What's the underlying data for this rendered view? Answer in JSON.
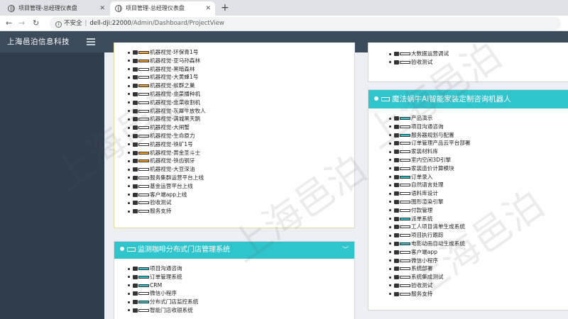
{
  "browser": {
    "tabs": [
      {
        "title": "项目管理-总经理仪表盘",
        "active": false
      },
      {
        "title": "项目管理-总经理仪表盘",
        "active": true
      }
    ],
    "insecure_label": "不安全",
    "host": "dell-dji:22000",
    "path": "/Admin/Dashboard/ProjectView"
  },
  "app": {
    "brand": "上海邑泊信息科技"
  },
  "panel_left_top": {
    "items": [
      {
        "label": "机器视觉-环保青1号",
        "icon": "robot-icon",
        "bar": "orange"
      },
      {
        "label": "机器视觉-亚马孙森林",
        "icon": "robot-icon",
        "bar": "orange"
      },
      {
        "label": "机器视觉-黑暗森林",
        "icon": "robot-icon",
        "bar": "white"
      },
      {
        "label": "机器视觉-大黄蜂1号",
        "icon": "robot-icon",
        "bar": "white"
      },
      {
        "label": "机器视觉-蚁群之巢",
        "icon": "robot-icon",
        "bar": "orange"
      },
      {
        "label": "机器视觉-韭菜播种机",
        "icon": "robot-icon",
        "bar": "white"
      },
      {
        "label": "机器视觉-韭菜收割机",
        "icon": "robot-icon",
        "bar": "white"
      },
      {
        "label": "机器视觉-灰犀牛放牧人",
        "icon": "robot-icon",
        "bar": "white"
      },
      {
        "label": "机器视觉-满城黑天鹅",
        "icon": "robot-icon",
        "bar": "white"
      },
      {
        "label": "机器视觉-大闸蟹",
        "icon": "robot-icon",
        "bar": "white"
      },
      {
        "label": "机器视觉-生命原力",
        "icon": "robot-icon",
        "bar": "white"
      },
      {
        "label": "机器视觉-铁矿1号",
        "icon": "robot-icon",
        "bar": "white"
      },
      {
        "label": "机器视觉-黄金圣斗士",
        "icon": "robot-icon",
        "bar": "orange"
      },
      {
        "label": "机器视觉-铁齿钢牙",
        "icon": "robot-icon",
        "bar": "orange"
      },
      {
        "label": "机器视觉-大豆深油",
        "icon": "robot-icon",
        "bar": "white"
      },
      {
        "label": "服务集群运营平台上线",
        "icon": "send-icon",
        "bar": "white"
      },
      {
        "label": "基金运营平台上线",
        "icon": "send-icon",
        "bar": "white"
      },
      {
        "label": "客户端app上线",
        "icon": "cube-icon",
        "bar": "white"
      },
      {
        "label": "验收测试",
        "icon": "users-icon",
        "bar": "white"
      },
      {
        "label": "服务支持",
        "icon": "arrow-up-icon",
        "bar": "white"
      }
    ]
  },
  "panel_left_bottom": {
    "title": "监测咖啡分布式门店管理系统",
    "items": [
      {
        "label": "项目沟通咨询",
        "icon": "chat-icon",
        "bar": "teal"
      },
      {
        "label": "订单管理系统",
        "icon": "cube-icon",
        "bar": "teal"
      },
      {
        "label": "CRM",
        "icon": "cube-icon",
        "bar": "teal"
      },
      {
        "label": "微信小程序",
        "icon": "cube-icon",
        "bar": "white"
      },
      {
        "label": "分布式门店监控系统",
        "icon": "cube-icon",
        "bar": "teal"
      },
      {
        "label": "智能门店收银系统",
        "icon": "cube-icon",
        "bar": "white"
      }
    ]
  },
  "panel_right_top": {
    "items": [
      {
        "label": "大数据运营调试",
        "icon": "cube-icon",
        "bar": "white"
      },
      {
        "label": "验收测试",
        "icon": "sign-in-icon",
        "bar": "white"
      }
    ]
  },
  "panel_right_main": {
    "title": "魔法蜗牛AI智能家装定制咨询机器人",
    "items": [
      {
        "label": "产品演示",
        "icon": "grid-icon",
        "bar": "teal"
      },
      {
        "label": "项目沟通咨询",
        "icon": "chat-icon",
        "bar": "white"
      },
      {
        "label": "服务器规划与配置",
        "icon": "server-icon",
        "bar": "teal"
      },
      {
        "label": "订单管理产品云平台部署",
        "icon": "anchor-icon",
        "bar": "white"
      },
      {
        "label": "家装材料库",
        "icon": "wrench-icon",
        "bar": "white"
      },
      {
        "label": "室内空间3D引擎",
        "icon": "bell-icon",
        "bar": "white"
      },
      {
        "label": "家装造价计算模块",
        "icon": "calendar-icon",
        "bar": "white"
      },
      {
        "label": "订单录入",
        "icon": "check-icon",
        "bar": "teal"
      },
      {
        "label": "自然语言处理",
        "icon": "chat-icon",
        "bar": "white"
      },
      {
        "label": "语料库设计",
        "icon": "sitemap-icon",
        "bar": "white"
      },
      {
        "label": "图形渲染引擎",
        "icon": "bookmark-icon",
        "bar": "white"
      },
      {
        "label": "付款管理",
        "icon": "crop-icon",
        "bar": "white"
      },
      {
        "label": "派单系统",
        "icon": "cube-icon",
        "bar": "teal"
      },
      {
        "label": "工人项目清单生成系统",
        "icon": "pin-icon",
        "bar": "white"
      },
      {
        "label": "项目执行跟踪",
        "icon": "gear-icon",
        "bar": "white"
      },
      {
        "label": "电影动画自动生成系统",
        "icon": "film-icon",
        "bar": "teal"
      },
      {
        "label": "客户端app",
        "icon": "sitemap-icon",
        "bar": "white"
      },
      {
        "label": "微信小程序",
        "icon": "trophy-icon",
        "bar": "white"
      },
      {
        "label": "系统部署",
        "icon": "cube-icon",
        "bar": "white"
      },
      {
        "label": "系统集成测试",
        "icon": "file-icon",
        "bar": "white"
      },
      {
        "label": "验收测试",
        "icon": "sign-in-icon",
        "bar": "white"
      },
      {
        "label": "服务支持",
        "icon": "cube-icon",
        "bar": "white"
      }
    ]
  },
  "watermark": "上海邑泊"
}
